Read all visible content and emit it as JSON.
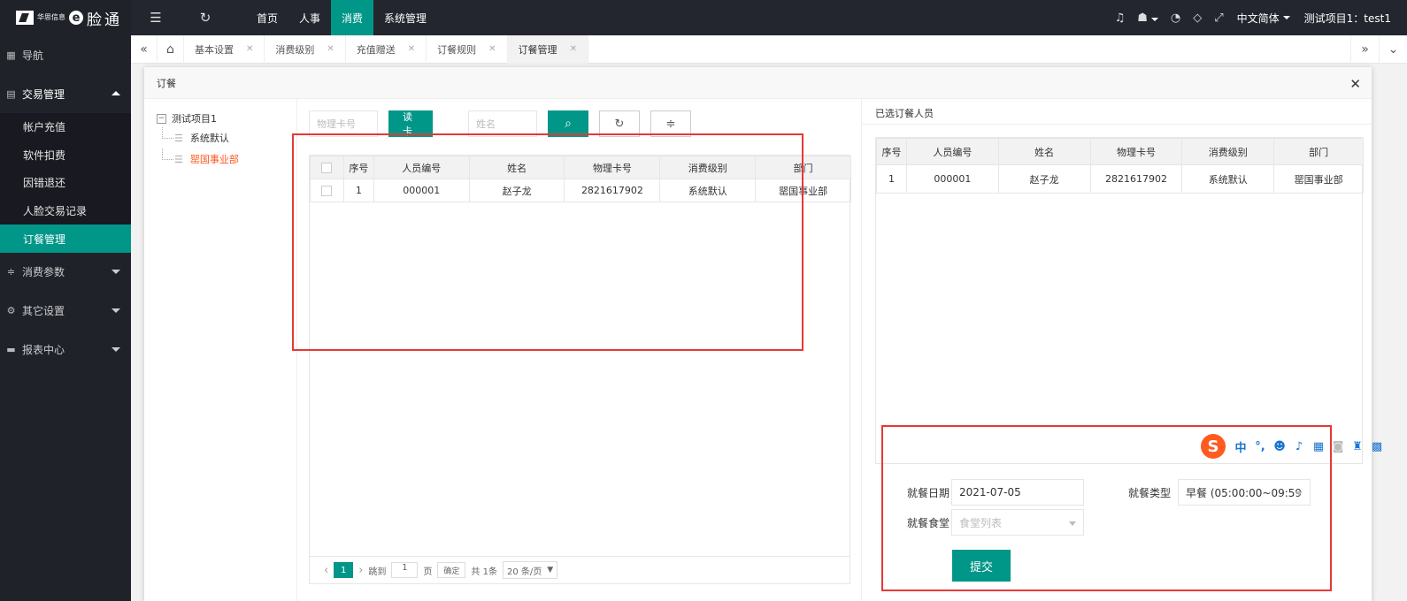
{
  "brand": {
    "company": "华思信息",
    "logo_letter": "e",
    "product": "脸通"
  },
  "sidebar": {
    "nav_label": "导航",
    "groups": [
      {
        "label": "交易管理",
        "open": true,
        "icon": "doc-icon",
        "items": [
          "帐户充值",
          "软件扣费",
          "因错退还",
          "人脸交易记录",
          "订餐管理"
        ]
      },
      {
        "label": "消费参数",
        "open": false,
        "icon": "sliders-icon"
      },
      {
        "label": "其它设置",
        "open": false,
        "icon": "gear-icon"
      },
      {
        "label": "报表中心",
        "open": false,
        "icon": "chat-icon"
      }
    ],
    "active_item": "订餐管理"
  },
  "topbar": {
    "menus": [
      "首页",
      "人事",
      "消费",
      "系统管理"
    ],
    "active_menu": "消费",
    "language": "中文简体",
    "project_user": "测试项目1：test1"
  },
  "tabs": [
    {
      "label": "基本设置",
      "active": false
    },
    {
      "label": "消费级别",
      "active": false
    },
    {
      "label": "充值赠送",
      "active": false
    },
    {
      "label": "订餐规则",
      "active": false
    },
    {
      "label": "订餐管理",
      "active": true
    }
  ],
  "dialog": {
    "title": "订餐",
    "tree": {
      "root": "测试项目1",
      "children": [
        {
          "label": "系统默认",
          "selected": false
        },
        {
          "label": "罂国事业部",
          "selected": true
        }
      ]
    },
    "search": {
      "card_placeholder": "物理卡号",
      "read_card_label": "读卡",
      "name_placeholder": "姓名"
    },
    "left_table": {
      "columns": [
        "序号",
        "人员编号",
        "姓名",
        "物理卡号",
        "消费级别",
        "部门"
      ],
      "rows": [
        {
          "no": "1",
          "emp_id": "000001",
          "name": "赵子龙",
          "card": "2821617902",
          "level": "系统默认",
          "dept": "罂国事业部"
        }
      ]
    },
    "pager": {
      "current_page": "1",
      "goto_label": "跳到",
      "goto_value": "1",
      "page_unit": "页",
      "confirm_label": "确定",
      "total_label": "共 1条",
      "page_size": "20 条/页"
    },
    "right": {
      "title": "已选订餐人员",
      "columns": [
        "序号",
        "人员编号",
        "姓名",
        "物理卡号",
        "消费级别",
        "部门"
      ],
      "rows": [
        {
          "no": "1",
          "emp_id": "000001",
          "name": "赵子龙",
          "card": "2821617902",
          "level": "系统默认",
          "dept": "罂国事业部"
        }
      ],
      "form": {
        "date_label": "就餐日期",
        "date_value": "2021-07-05",
        "type_label": "就餐类型",
        "type_value": "早餐 (05:00:00~09:59",
        "canteen_label": "就餐食堂",
        "canteen_placeholder": "食堂列表",
        "submit_label": "提交"
      }
    }
  },
  "ime": {
    "logo": "S",
    "mode": "中",
    "punct": "°,"
  }
}
